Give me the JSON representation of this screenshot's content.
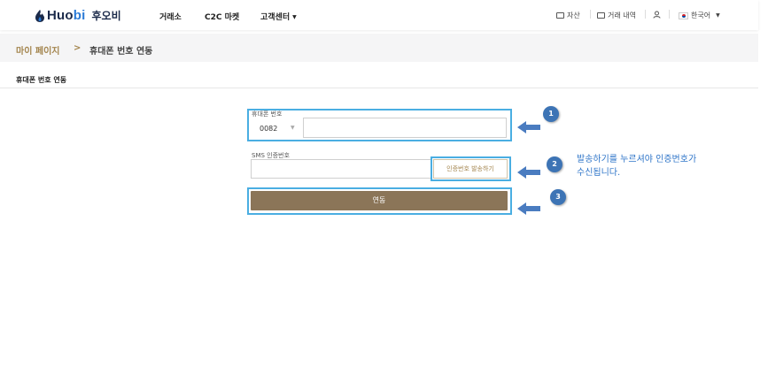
{
  "header": {
    "logo_word_main": "Huo",
    "logo_word_accent": "bi",
    "logo_korean": "후오비",
    "nav": [
      {
        "label": "거래소"
      },
      {
        "label": "C2C 마켓"
      },
      {
        "label": "고객센터",
        "has_dropdown": true
      }
    ],
    "right": {
      "assets_label": "자산",
      "orders_label": "거래 내역",
      "language_label": "한국어"
    },
    "icons": [
      "huobi-flame-icon",
      "wallet-icon",
      "orders-icon",
      "user-icon",
      "korea-flag-icon",
      "chevron-down-icon"
    ]
  },
  "breadcrumb": {
    "root": "마이 페이지",
    "separator": ">",
    "current": "휴대폰 번호 연동"
  },
  "section": {
    "title": "휴대폰 번호 연동"
  },
  "form": {
    "phone_label": "휴대폰 번호",
    "country_code": "0082",
    "phone_value": "",
    "sms_label": "SMS 인증번호",
    "sms_value": "",
    "send_button": "인증번호 발송하기",
    "submit_button": "연동"
  },
  "annotations": {
    "badges": [
      "1",
      "2",
      "3"
    ],
    "note_line1": "발송하기를 누르셔야 인증번호가",
    "note_line2": "수신됩니다.",
    "highlight_color": "#4aaee2",
    "badge_color": "#3d74b5",
    "arrow_color": "#4a7cc0"
  },
  "colors": {
    "brand_gold": "#a4864f",
    "submit_bg": "#8b7558",
    "logo_navy": "#1b2a4a"
  }
}
